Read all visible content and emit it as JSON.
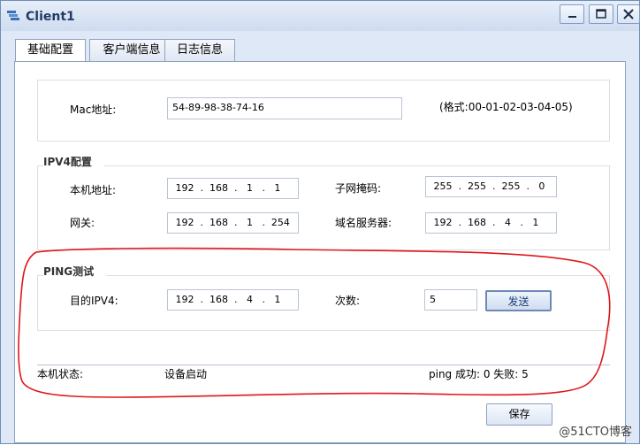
{
  "window": {
    "title": "Client1",
    "controls": {
      "minimize": "minimize",
      "maximize": "maximize",
      "close": "close"
    }
  },
  "tabs": [
    {
      "label": "基础配置",
      "active": true
    },
    {
      "label": "客户端信息",
      "active": false
    },
    {
      "label": "日志信息",
      "active": false
    }
  ],
  "mac": {
    "label": "Mac地址:",
    "value": "54-89-98-38-74-16",
    "format_hint": "(格式:00-01-02-03-04-05)"
  },
  "ipv4": {
    "title": "IPV4配置",
    "local_ip": {
      "label": "本机地址:",
      "value": " 192  .  168  .   1   .   1"
    },
    "subnet_mask": {
      "label": "子网掩码:",
      "value": " 255  .  255  .  255  .   0"
    },
    "gateway": {
      "label": "网关:",
      "value": " 192  .  168  .   1   .  254"
    },
    "dns": {
      "label": "域名服务器:",
      "value": " 192  .  168  .   4   .   1"
    }
  },
  "ping": {
    "title": "PING测试",
    "target": {
      "label": "目的IPV4:",
      "value": " 192  .  168  .   4   .   1"
    },
    "count": {
      "label": "次数:",
      "value": "5"
    },
    "send_label": "发送"
  },
  "status": {
    "label": "本机状态:",
    "value": "设备启动",
    "ping_summary": "ping 成功: 0    失败: 5"
  },
  "save_label": "保存",
  "watermark": "@51CTO博客",
  "colors": {
    "annotation": "#e0161b",
    "window_bg": "#dfe8f6",
    "title_text": "#1f3b68"
  }
}
